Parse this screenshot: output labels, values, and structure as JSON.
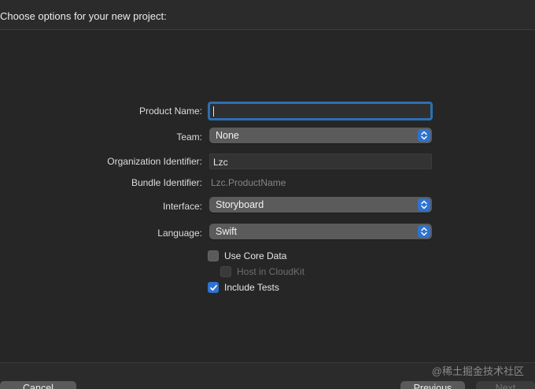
{
  "header": {
    "title": "Choose options for your new project:"
  },
  "form": {
    "product_name": {
      "label": "Product Name:",
      "value": ""
    },
    "team": {
      "label": "Team:",
      "selected": "None"
    },
    "organization_identifier": {
      "label": "Organization Identifier:",
      "value": "Lzc"
    },
    "bundle_identifier": {
      "label": "Bundle Identifier:",
      "value": "Lzc.ProductName"
    },
    "interface": {
      "label": "Interface:",
      "selected": "Storyboard"
    },
    "language": {
      "label": "Language:",
      "selected": "Swift"
    },
    "use_core_data": {
      "label": "Use Core Data",
      "checked": false
    },
    "host_in_cloudkit": {
      "label": "Host in CloudKit",
      "checked": false,
      "enabled": false
    },
    "include_tests": {
      "label": "Include Tests",
      "checked": true
    }
  },
  "footer": {
    "cancel_label": "Cancel",
    "previous_label": "Previous",
    "next_label": "Next"
  },
  "watermark": "@稀土掘金技术社区",
  "colors": {
    "accent": "#2f72d1",
    "focus_ring": "#2c6fb3",
    "background": "#262626"
  },
  "icons": {
    "stepper": "up-down-chevron-icon",
    "checkmark": "checkmark-icon"
  }
}
